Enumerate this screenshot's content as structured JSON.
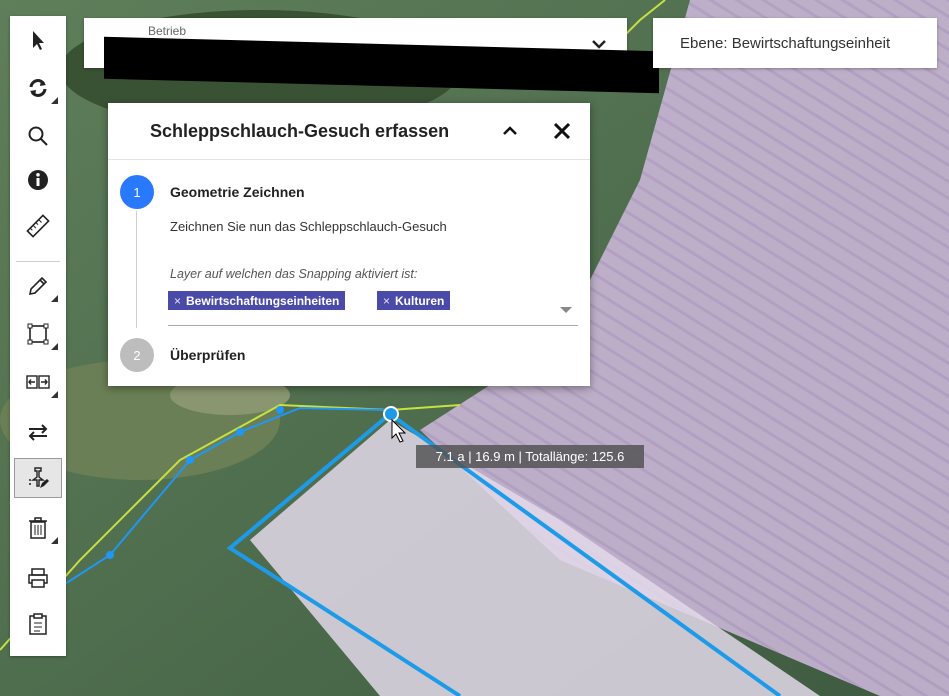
{
  "header": {
    "betrieb_label": "Betrieb",
    "layer_label": "Ebene: Bewirtschaftungseinheit"
  },
  "toolbar": {
    "tools": [
      "select",
      "refresh",
      "search",
      "info",
      "measure",
      "draw",
      "bbox",
      "split",
      "swap",
      "snap-draw",
      "delete",
      "print",
      "list"
    ]
  },
  "dialog": {
    "title": "Schleppschlauch-Gesuch erfassen",
    "steps": [
      {
        "number": "1",
        "title": "Geometrie Zeichnen",
        "description": "Zeichnen Sie nun das Schleppschlauch-Gesuch",
        "snapping_label": "Layer auf welchen das Snapping aktiviert ist:",
        "chips": [
          {
            "remove": "×",
            "label": "Bewirtschaftungseinheiten"
          },
          {
            "remove": "×",
            "label": "Kulturen"
          }
        ]
      },
      {
        "number": "2",
        "title": "Überprüfen"
      }
    ]
  },
  "measure_tooltip": "7.1 a | 16.9 m | Totallänge: 125.6",
  "colors": {
    "accent": "#2979ff",
    "chip": "#4a4aa8",
    "draw_line": "#1e9be8",
    "parcel_fill": "#d9c8e8",
    "step_inactive": "#bdbdbd"
  }
}
